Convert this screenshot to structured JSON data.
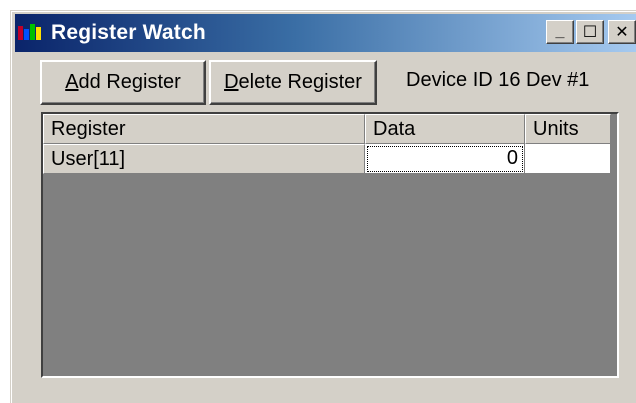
{
  "window": {
    "title": "Register Watch",
    "controls": {
      "minimize": "_",
      "maximize": "☐",
      "close": "✕"
    }
  },
  "toolbar": {
    "add_label_accel": "A",
    "add_label_rest": "dd Register",
    "delete_label_accel": "D",
    "delete_label_rest": "elete Register",
    "device_info": "Device ID 16  Dev #1"
  },
  "grid": {
    "columns": [
      "Register",
      "Data",
      "Units"
    ],
    "rows": [
      {
        "register": "User[11]",
        "data": "0",
        "units": ""
      }
    ]
  },
  "colors": {
    "titlebar_start": "#0a246a",
    "titlebar_end": "#a6caf0",
    "window_face": "#d4d0c8",
    "grid_background": "#808080"
  }
}
